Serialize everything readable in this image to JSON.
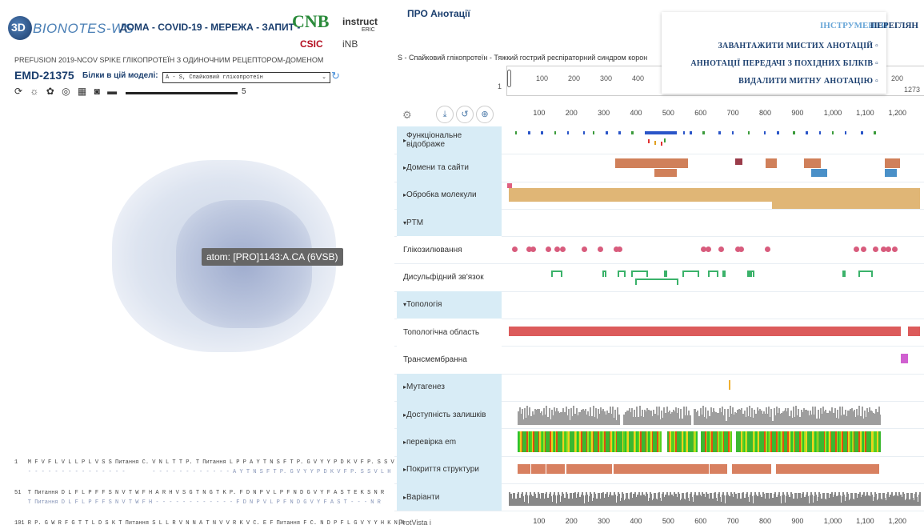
{
  "left": {
    "logo_text": "3D",
    "brand": "BIONOTES-WS",
    "nav": "ДОМА - COVID-19 - МЕРЕЖА - ЗАПИТ -",
    "cnb": "CNB",
    "csic": "CSIC",
    "instruct": "instruct",
    "instruct_sub": "ERIC",
    "inb": "iNB",
    "subtitle": "PREFUSION 2019-NCOV SPIKE ГЛІКОПРОТЕЇН З ОДИНОЧНИМ РЕЦЕПТОРОМ-ДОМЕНОМ",
    "emd": "EMD-21375",
    "models_label": "Білки в цій моделі:",
    "select_value": "A - S, Спайковий глікопротеїн",
    "toolbar_icons": [
      "refresh-icon",
      "sun-icon",
      "leaf-icon",
      "globe-icon",
      "grid-icon",
      "camera-icon",
      "film-icon"
    ],
    "toolbar_glyphs": "⟳ ☼ ✿ ◎ ▦ ◙ ▬",
    "slider_value": "5",
    "tooltip": "atom: [PRO]1143:A.CA (6VSB)",
    "seq_lines": [
      "1   M F V F L V L L P L V S S Питання C. V N L T T P. T Питання L P P A Y T N S F T P. G V Y Y P D K V F P. S S V L H",
      "    - - - - - - - - - - - - - - -        - - - - - - - - - - - - A Y T N S F T P. G V Y Y P D K V F P. S S V L H",
      "51  T Питання D L F L P F F S N V T W F H A R H V S G T N G T K P. F D N P V L P F N D G V Y F A S T E K S N R",
      "    T Питання D L F L P F F S N V T W F H - - - - - - - - - - - - F D N P V L P F N D G V Y F A S T - - - N R",
      "101 R P. G W R F G T T L D S K T Питання S L L R V N N A T N V V R K V C. E F Питання F C. N D P F L G V Y Y H K N N"
    ]
  },
  "right": {
    "title": "ПРО Анотації",
    "tools_label": "ІНСТРУМЕНТИ",
    "view_label": "ПЕРЕГЛЯН",
    "menu_items": [
      "ЗАВАНТАЖИТИ МИСТИХ АНОТАЦІЙ ▫",
      "АННОТАЦІЇ ПЕРЕДАЧІ З ПОХІДНИХ БІЛКІВ ▫",
      "ВИДАЛИТИ МИТНУ АНОТАЦІЮ ▫"
    ],
    "protein_line": "S - Спайковий глікопротеїн - Тяжкий гострий респіраторний синдром корон",
    "nav_ticks": [
      "100",
      "200",
      "300",
      "400"
    ],
    "nav_right": "200",
    "nav_start": "1",
    "nav_end": "1273",
    "ruler_ticks": [
      "100",
      "200",
      "300",
      "400",
      "500",
      "600",
      "700",
      "800",
      "900",
      "1,000",
      "1,100",
      "1,200"
    ],
    "tracks": [
      {
        "label": "Функціональне відображе",
        "style": "category"
      },
      {
        "label": "Домени та сайти",
        "style": "category"
      },
      {
        "label": "Обробка молекули",
        "style": "category"
      },
      {
        "label": "PTM",
        "style": "category-open"
      },
      {
        "label": "Глікозилювання",
        "style": "plain"
      },
      {
        "label": "Дисульфідний зв'язок",
        "style": "plain"
      },
      {
        "label": "Топологія",
        "style": "category-open"
      },
      {
        "label": "Топологічна область",
        "style": "plain"
      },
      {
        "label": "Трансмембранна",
        "style": "plain"
      },
      {
        "label": "Мутагенез",
        "style": "category"
      },
      {
        "label": "Доступність залишків",
        "style": "category"
      },
      {
        "label": "перевірка em",
        "style": "category"
      },
      {
        "label": "Покриття структури",
        "style": "category"
      },
      {
        "label": "Варіанти",
        "style": "category"
      }
    ],
    "footer": "ProtVista i",
    "colors": {
      "domain": "#d0805a",
      "domain2": "#4a90c8",
      "processing": "#e0b676",
      "glyco": "#d85c7d",
      "disulfide": "#3bb26a",
      "topology": "#dc5b5b",
      "transmembrane": "#d060d0",
      "mutagenesis": "#f0b030",
      "coverage": "#d88060",
      "label_bg": "#d8ecf6"
    }
  }
}
